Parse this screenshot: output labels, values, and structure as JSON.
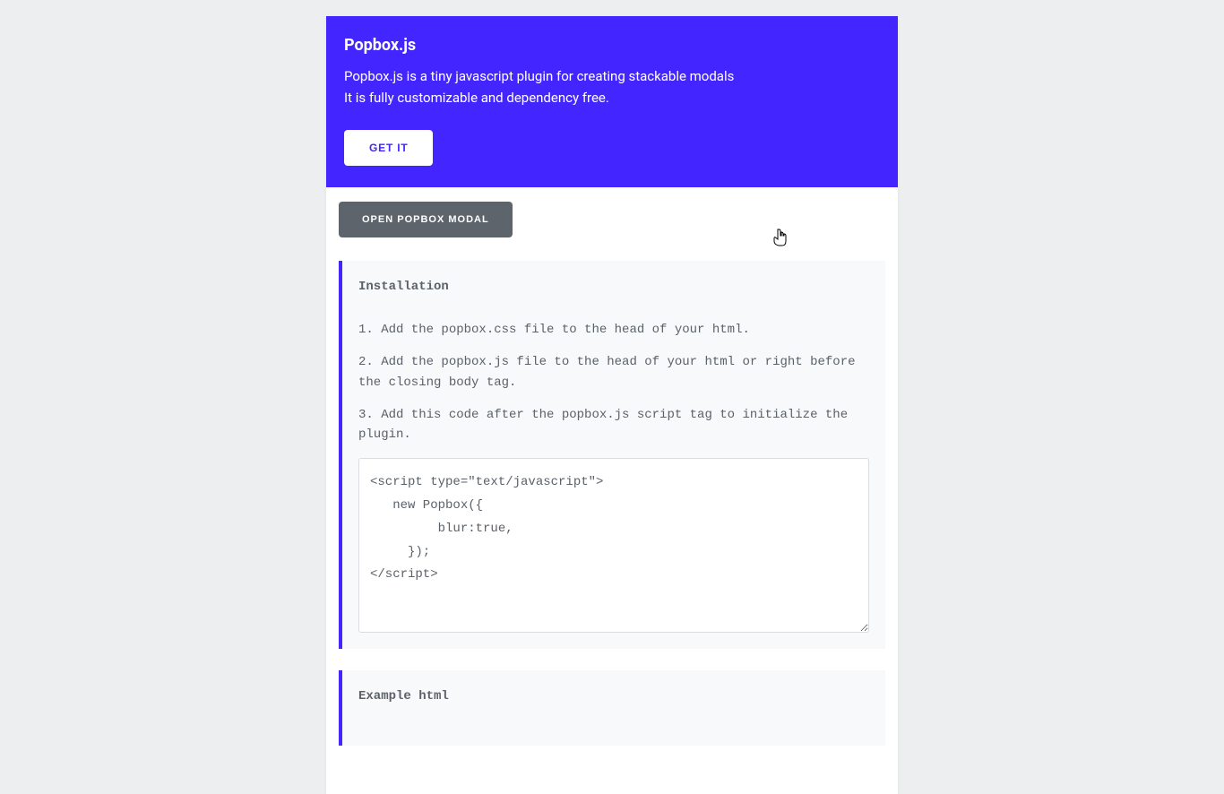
{
  "hero": {
    "title": "Popbox.js",
    "desc_line1": "Popbox.js is a tiny javascript plugin for creating stackable modals",
    "desc_line2": "It is fully customizable and dependency free.",
    "get_label": "GET IT"
  },
  "open_button_label": "OPEN POPBOX MODAL",
  "installation": {
    "title": "Installation",
    "step1": "1. Add the popbox.css file to the head of your html.",
    "step2": "2. Add the popbox.js file to the head of your html or right before the closing body tag.",
    "step3": "3. Add this code after the popbox.js script tag to initialize the plugin.",
    "code": "<script type=\"text/javascript\">\n   new Popbox({\n         blur:true,\n     });\n</script>"
  },
  "example": {
    "title": "Example html"
  }
}
